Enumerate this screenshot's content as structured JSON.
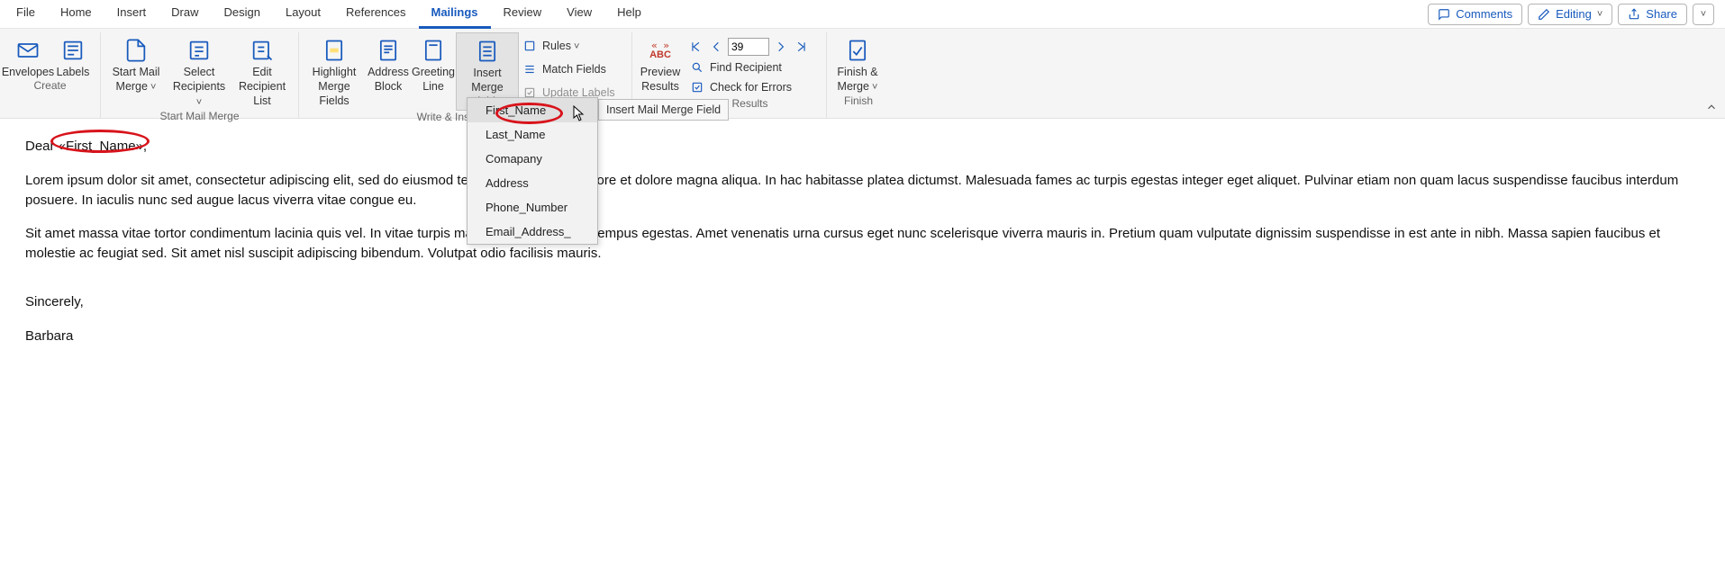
{
  "tabs": {
    "items": [
      "File",
      "Home",
      "Insert",
      "Draw",
      "Design",
      "Layout",
      "References",
      "Mailings",
      "Review",
      "View",
      "Help"
    ],
    "active_index": 7
  },
  "topright": {
    "comments": "Comments",
    "editing": "Editing",
    "share": "Share"
  },
  "ribbon": {
    "create": {
      "label": "Create",
      "envelopes": "Envelopes",
      "labels": "Labels"
    },
    "start": {
      "label": "Start Mail Merge",
      "start_merge": "Start Mail\nMerge",
      "select_recip": "Select\nRecipients",
      "edit_recip": "Edit\nRecipient List"
    },
    "write": {
      "label": "Write & Insert Fields",
      "highlight": "Highlight\nMerge Fields",
      "address": "Address\nBlock",
      "greeting": "Greeting\nLine",
      "insert_merge": "Insert Merge\nField",
      "rules": "Rules",
      "match": "Match Fields",
      "update": "Update Labels"
    },
    "preview": {
      "label": "Preview Results",
      "preview": "Preview\nResults",
      "abc": "ABC",
      "nav_value": "39",
      "find": "Find Recipient",
      "errors": "Check for Errors"
    },
    "finish": {
      "label": "Finish",
      "finish": "Finish &\nMerge"
    }
  },
  "tooltip": "Insert Mail Merge Field",
  "menu": {
    "items": [
      "First_Name",
      "Last_Name",
      "Comapany",
      "Address",
      "Phone_Number",
      "Email_Address_"
    ],
    "highlighted": 0
  },
  "document": {
    "greeting_prefix": "Dear ",
    "greeting_field": "«First_Name»",
    "greeting_suffix": ",",
    "p1": "Lorem ipsum dolor sit amet, consectetur adipiscing elit, sed do eiusmod tempor incididunt ut labore et dolore magna aliqua. In hac habitasse platea dictumst. Malesuada fames ac turpis egestas integer eget aliquet. Pulvinar etiam non quam lacus suspendisse faucibus interdum posuere. In iaculis nunc sed augue lacus viverra vitae congue eu.",
    "p2": "Sit amet massa vitae tortor condimentum lacinia quis vel. In vitae turpis massa sed elementum tempus egestas. Amet venenatis urna cursus eget nunc scelerisque viverra mauris in. Pretium quam vulputate dignissim suspendisse in est ante in nibh. Massa sapien faucibus et molestie ac feugiat sed. Sit amet nisl suscipit adipiscing bibendum. Volutpat odio facilisis mauris.",
    "closing": "Sincerely,",
    "sender": "Barbara"
  }
}
